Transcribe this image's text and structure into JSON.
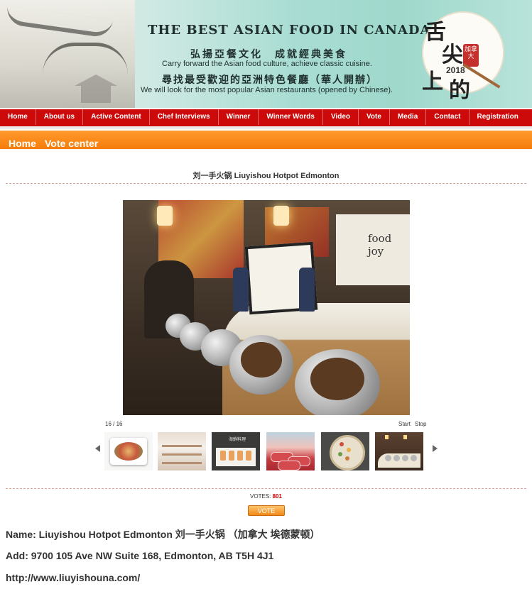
{
  "banner": {
    "title": "THE BEST ASIAN FOOD IN CANADA",
    "cn_line1": "弘揚亞餐文化　成就經典美食",
    "en_line1": "Carry forward the Asian food culture, achieve classic cuisine.",
    "cn_line2": "尋找最受歡迎的亞洲特色餐廳（華人開辦）",
    "en_line2": "We will look for the most popular Asian restaurants (opened by Chinese).",
    "logo": {
      "char1": "舌",
      "char2": "尖",
      "char3": "上",
      "char4": "的",
      "tag": "加拿大",
      "year": "2018"
    }
  },
  "nav": {
    "items": [
      {
        "label": "Home"
      },
      {
        "label": "About us"
      },
      {
        "label": "Active Content"
      },
      {
        "label": "Chef Interviews"
      },
      {
        "label": "Winner"
      },
      {
        "label": "Winner Words"
      },
      {
        "label": "Video"
      },
      {
        "label": "Vote"
      },
      {
        "label": "Media"
      },
      {
        "label": "Contact"
      },
      {
        "label": "Registration"
      }
    ]
  },
  "breadcrumb": {
    "home": "Home",
    "current": "Vote center"
  },
  "restaurant": {
    "title": "刘一手火锅 Liuyishou Hotpot Edmonton",
    "photo_sign": "food joy"
  },
  "gallery": {
    "counter": "16 / 16",
    "start": "Start",
    "stop": "Stop",
    "thumb3_caption": "海鮮料理"
  },
  "vote": {
    "label": "VOTES:",
    "count": "801",
    "button": "VOTE"
  },
  "details": {
    "name": "Name: Liuyishou Hotpot Edmonton 刘一手火锅 （加拿大 埃德蒙顿）",
    "address": "Add: 9700 105 Ave NW  Suite 168, Edmonton, AB T5H 4J1",
    "website": "http://www.liuyishouna.com/"
  },
  "colors": {
    "nav_red": "#cc0a0a",
    "crumb_orange": "#f57d0a",
    "vote_count_red": "#cc0000"
  }
}
